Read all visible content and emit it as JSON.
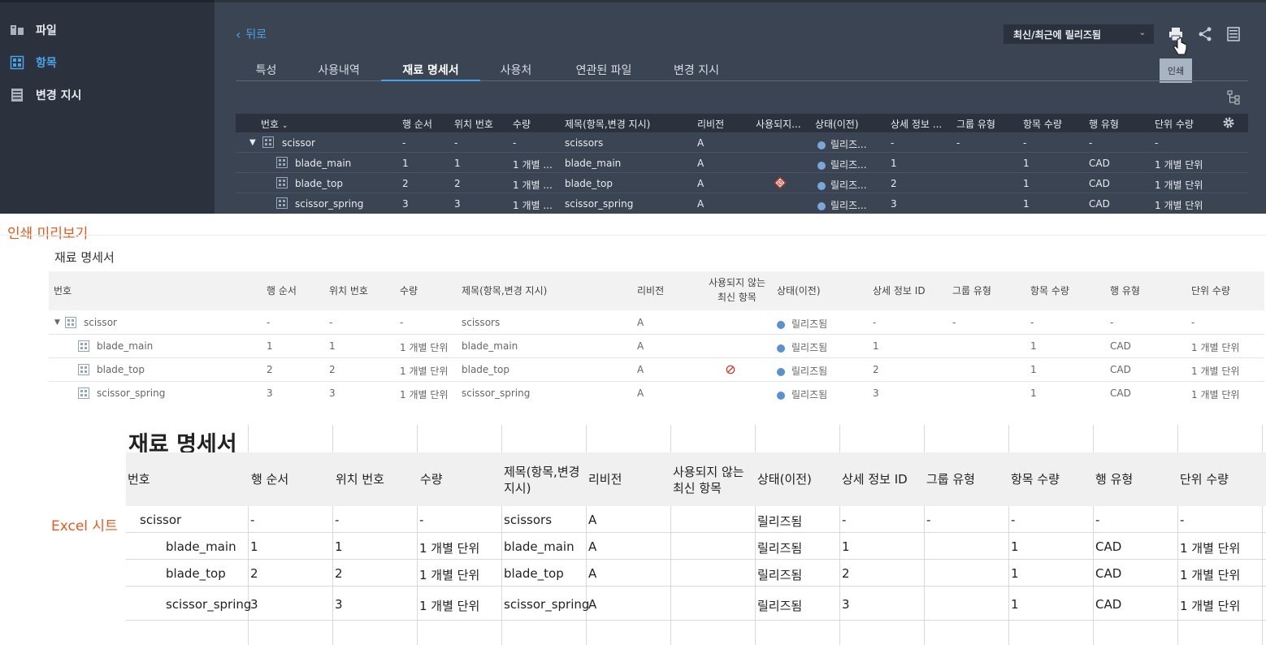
{
  "sidebar": {
    "items": [
      {
        "label": "파일",
        "icon": "files-icon"
      },
      {
        "label": "항목",
        "icon": "grid-item-icon"
      },
      {
        "label": "변경 지시",
        "icon": "list-icon"
      }
    ]
  },
  "toolbar": {
    "back_label": "뒤로",
    "release_select": "최신/최근에 릴리즈됨",
    "print_tooltip": "인쇄"
  },
  "tabs": [
    "특성",
    "사용내역",
    "재료 명세서",
    "사용처",
    "연관된 파일",
    "변경 지시"
  ],
  "grid": {
    "headers": [
      "번호",
      "행 순서",
      "위치 번호",
      "수량",
      "제목(항목,변경 지시)",
      "리비전",
      "사용되지...",
      "상태(이전)",
      "상세 정보 ...",
      "그룹 유형",
      "항목 수량",
      "행 유형",
      "단위 수량"
    ],
    "rows": [
      {
        "name": "scissor",
        "row": "-",
        "pos": "-",
        "qty": "-",
        "title": "scissors",
        "rev": "A",
        "status": "릴리즈...",
        "detail": "-",
        "group": "-",
        "item_qty": "-",
        "row_type": "-",
        "unit_qty": "-"
      },
      {
        "name": "blade_main",
        "row": "1",
        "pos": "1",
        "qty": "1 개별 ...",
        "title": "blade_main",
        "rev": "A",
        "status": "릴리즈...",
        "detail": "1",
        "group": "",
        "item_qty": "1",
        "row_type": "CAD",
        "unit_qty": "1 개별 단위"
      },
      {
        "name": "blade_top",
        "row": "2",
        "pos": "2",
        "qty": "1 개별 ...",
        "title": "blade_top",
        "rev": "A",
        "status": "릴리즈...",
        "detail": "2",
        "group": "",
        "item_qty": "1",
        "row_type": "CAD",
        "unit_qty": "1 개별 단위"
      },
      {
        "name": "scissor_spring",
        "row": "3",
        "pos": "3",
        "qty": "1 개별 ...",
        "title": "scissor_spring",
        "rev": "A",
        "status": "릴리즈...",
        "detail": "3",
        "group": "",
        "item_qty": "1",
        "row_type": "CAD",
        "unit_qty": "1 개별 단위"
      }
    ]
  },
  "print_preview": {
    "label": "인쇄 미리보기",
    "title": "재료 명세서",
    "headers": [
      "번호",
      "행 순서",
      "위치 번호",
      "수량",
      "제목(항목,변경 지시)",
      "리비전",
      "사용되지 않는 최신 항목",
      "상태(이전)",
      "상세 정보 ID",
      "그룹 유형",
      "항목 수량",
      "행 유형",
      "단위 수량"
    ],
    "rows": [
      {
        "name": "scissor",
        "row": "-",
        "pos": "-",
        "qty": "-",
        "title": "scissors",
        "rev": "A",
        "status": "릴리즈됨",
        "detail": "-",
        "group": "-",
        "item_qty": "-",
        "row_type": "-",
        "unit_qty": "-"
      },
      {
        "name": "blade_main",
        "row": "1",
        "pos": "1",
        "qty": "1 개별 단위",
        "title": "blade_main",
        "rev": "A",
        "status": "릴리즈됨",
        "detail": "1",
        "group": "",
        "item_qty": "1",
        "row_type": "CAD",
        "unit_qty": "1 개별 단위"
      },
      {
        "name": "blade_top",
        "row": "2",
        "pos": "2",
        "qty": "1 개별 단위",
        "title": "blade_top",
        "rev": "A",
        "status": "릴리즈됨",
        "detail": "2",
        "group": "",
        "item_qty": "1",
        "row_type": "CAD",
        "unit_qty": "1 개별 단위"
      },
      {
        "name": "scissor_spring",
        "row": "3",
        "pos": "3",
        "qty": "1 개별 단위",
        "title": "scissor_spring",
        "rev": "A",
        "status": "릴리즈됨",
        "detail": "3",
        "group": "",
        "item_qty": "1",
        "row_type": "CAD",
        "unit_qty": "1 개별 단위"
      }
    ]
  },
  "excel": {
    "label": "Excel 시트",
    "title": "재료 명세서",
    "headers": [
      "번호",
      "행 순서",
      "위치 번호",
      "수량",
      "제목(항목,변경 지시)",
      "리비전",
      "사용되지 않는 최신 항목",
      "상태(이전)",
      "상세 정보 ID",
      "그룹 유형",
      "항목 수량",
      "행 유형",
      "단위 수량"
    ],
    "rows": [
      {
        "name": "scissor",
        "row": "-",
        "pos": "-",
        "qty": "-",
        "title": "scissors",
        "rev": "A",
        "status": "릴리즈됨",
        "detail": "-",
        "group": "-",
        "item_qty": "-",
        "row_type": "-",
        "unit_qty": "-"
      },
      {
        "name": "blade_main",
        "row": "1",
        "pos": "1",
        "qty": "1 개별 단위",
        "title": "blade_main",
        "rev": "A",
        "status": "릴리즈됨",
        "detail": "1",
        "group": "",
        "item_qty": "1",
        "row_type": "CAD",
        "unit_qty": "1 개별 단위"
      },
      {
        "name": "blade_top",
        "row": "2",
        "pos": "2",
        "qty": "1 개별 단위",
        "title": "blade_top",
        "rev": "A",
        "status": "릴리즈됨",
        "detail": "2",
        "group": "",
        "item_qty": "1",
        "row_type": "CAD",
        "unit_qty": "1 개별 단위"
      },
      {
        "name": "scissor_spring",
        "row": "3",
        "pos": "3",
        "qty": "1 개별 단위",
        "title": "scissor_spring",
        "rev": "A",
        "status": "릴리즈됨",
        "detail": "3",
        "group": "",
        "item_qty": "1",
        "row_type": "CAD",
        "unit_qty": "1 개별 단위"
      }
    ]
  }
}
